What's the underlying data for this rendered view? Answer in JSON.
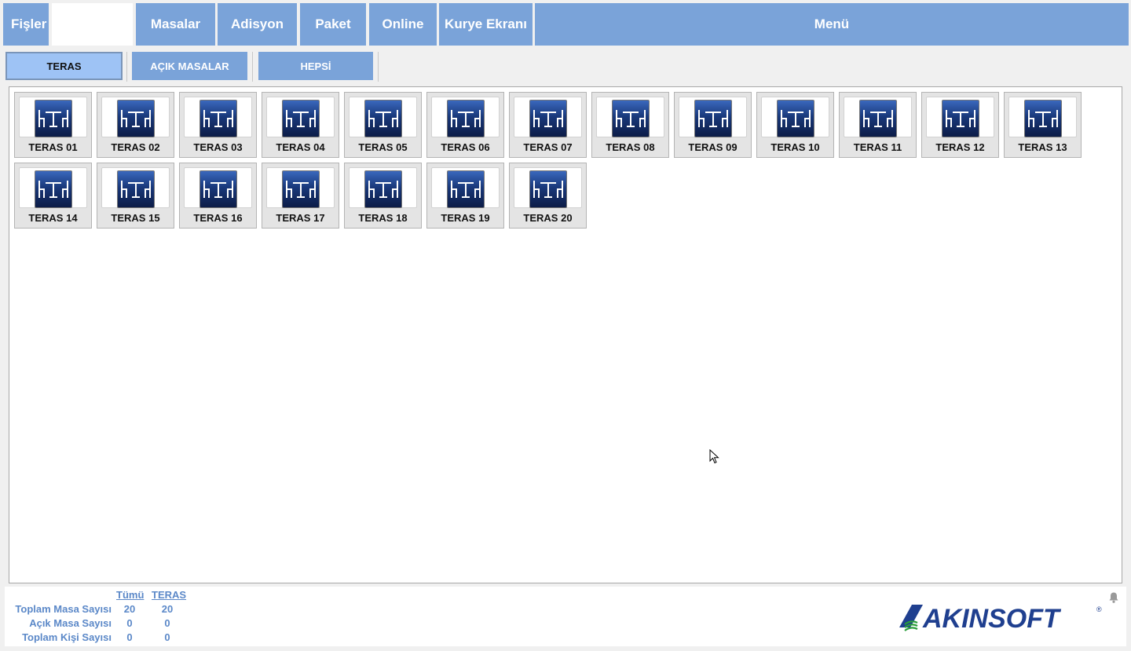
{
  "topnav": {
    "items": [
      {
        "label": "Fişler"
      },
      {
        "label": "Masalar"
      },
      {
        "label": "Adisyon"
      },
      {
        "label": "Paket"
      },
      {
        "label": "Online"
      },
      {
        "label": "Kurye Ekranı"
      },
      {
        "label": "Menü"
      }
    ]
  },
  "subtabs": [
    {
      "label": "TERAS",
      "active": true
    },
    {
      "label": "AÇIK MASALAR",
      "active": false
    },
    {
      "label": "HEPSİ",
      "active": false
    }
  ],
  "tables": [
    "TERAS 01",
    "TERAS 02",
    "TERAS 03",
    "TERAS 04",
    "TERAS 05",
    "TERAS 06",
    "TERAS 07",
    "TERAS 08",
    "TERAS 09",
    "TERAS 10",
    "TERAS 11",
    "TERAS 12",
    "TERAS 13",
    "TERAS 14",
    "TERAS 15",
    "TERAS 16",
    "TERAS 17",
    "TERAS 18",
    "TERAS 19",
    "TERAS 20"
  ],
  "table_icon": "table-chairs-icon",
  "stats": {
    "col_all": "Tümü",
    "col_area": "TERAS",
    "rows": [
      {
        "label": "Toplam Masa Sayısı",
        "all": "20",
        "area": "20"
      },
      {
        "label": "Açık Masa Sayısı",
        "all": "0",
        "area": "0"
      },
      {
        "label": "Toplam Kişi Sayısı",
        "all": "0",
        "area": "0"
      }
    ]
  },
  "brand": {
    "name": "AKINSOFT",
    "registered": "®"
  },
  "colors": {
    "nav": "#7aa3d9",
    "active_tab": "#9ec3f5",
    "stats_text": "#5b88c8",
    "brand": "#1f3f8f"
  }
}
